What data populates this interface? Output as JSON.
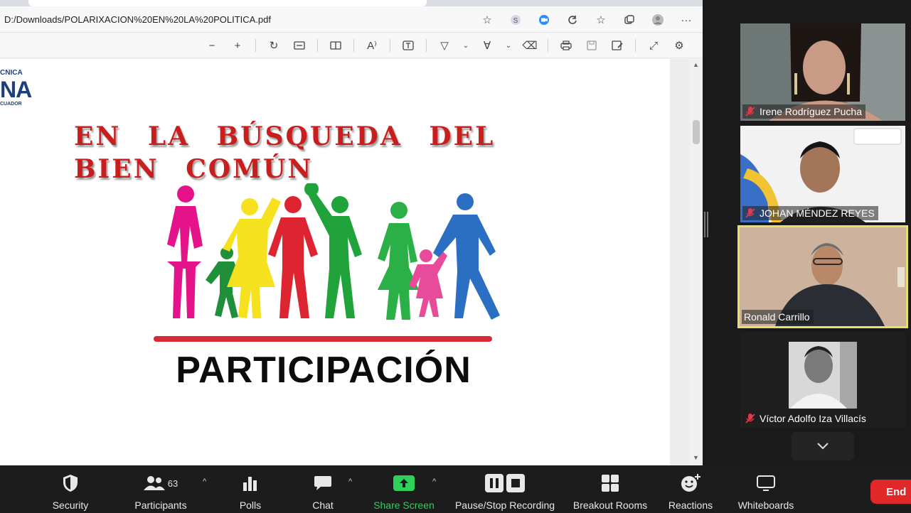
{
  "browser": {
    "url": "D:/Downloads/POLARIXACION%20EN%20LA%20POLITICA.pdf"
  },
  "slide": {
    "logo_line1": "CNICA",
    "logo_line2": "NA",
    "logo_line3": "CUADOR",
    "title": "EN LA BÚSQUEDA DEL BIEN COMÚN",
    "word": "PARTICIPACIÓN"
  },
  "participants": [
    {
      "name": "Irene Rodríguez Pucha",
      "muted": true,
      "active": false
    },
    {
      "name": "JOHAN MÉNDEZ REYES",
      "muted": true,
      "active": false
    },
    {
      "name": "Ronald Carrillo",
      "muted": false,
      "active": true
    },
    {
      "name": "Víctor Adolfo Iza Villacís",
      "muted": true,
      "active": false
    }
  ],
  "toolbar": {
    "security": "Security",
    "participants": "Participants",
    "participants_count": "63",
    "polls": "Polls",
    "chat": "Chat",
    "share_screen": "Share Screen",
    "recording": "Pause/Stop Recording",
    "breakout": "Breakout Rooms",
    "reactions": "Reactions",
    "whiteboards": "Whiteboards",
    "end": "End"
  },
  "colors": {
    "accent_green": "#2fd05a",
    "end_red": "#e02828",
    "active_border": "#e5e06e",
    "title_red": "#c81e1e"
  },
  "icons": [
    "shield-icon",
    "people-icon",
    "bar-chart-icon",
    "chat-bubble-icon",
    "share-arrow-icon",
    "pause-icon",
    "stop-icon",
    "grid-icon",
    "smile-plus-icon",
    "whiteboard-icon",
    "muted-mic-icon",
    "chevron-down-icon"
  ]
}
